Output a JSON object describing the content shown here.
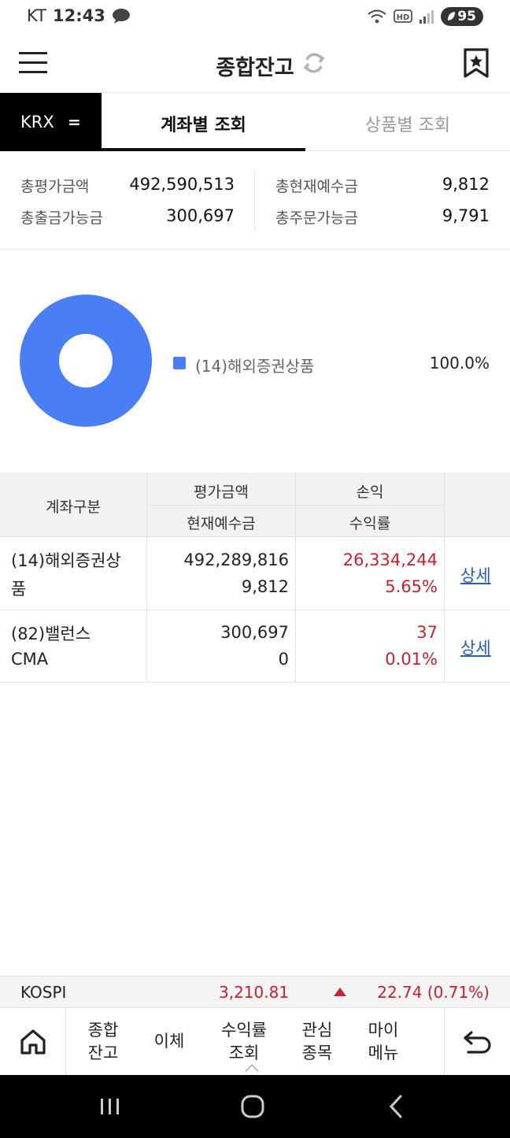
{
  "status_bar": {
    "carrier": "KT",
    "time": "12:43",
    "battery": "95"
  },
  "header": {
    "title": "종합잔고"
  },
  "tabs": {
    "exchange": "KRX",
    "exchange_icon": "=",
    "items": [
      {
        "label": "계좌별 조회",
        "active": true
      },
      {
        "label": "상품별 조회",
        "active": false
      }
    ]
  },
  "summary": {
    "left": [
      {
        "label": "총평가금액",
        "value": "492,590,513"
      },
      {
        "label": "총출금가능금",
        "value": "300,697"
      }
    ],
    "right": [
      {
        "label": "총현재예수금",
        "value": "9,812"
      },
      {
        "label": "총주문가능금",
        "value": "9,791"
      }
    ]
  },
  "chart_data": {
    "type": "pie",
    "categories": [
      "(14)해외증권상품"
    ],
    "values": [
      100.0
    ],
    "value_labels": [
      "100.0%"
    ],
    "colors": [
      "#4a7ef5"
    ],
    "legend_position": "right"
  },
  "table": {
    "headers": {
      "account": "계좌구분",
      "eval_amount": "평가금액",
      "deposit": "현재예수금",
      "profit": "손익",
      "return_rate": "수익률"
    },
    "rows": [
      {
        "account_line1": "(14)해외증권상",
        "account_line2": "품",
        "eval_amount": "492,289,816",
        "deposit": "9,812",
        "profit": "26,334,244",
        "return_rate": "5.65%",
        "detail": "상세"
      },
      {
        "account_line1": "(82)밸런스",
        "account_line2": "CMA",
        "eval_amount": "300,697",
        "deposit": "0",
        "profit": "37",
        "return_rate": "0.01%",
        "detail": "상세"
      }
    ]
  },
  "ticker": {
    "name": "KOSPI",
    "price": "3,210.81",
    "change": "22.74 (0.71%)",
    "color_up": "#c8202f"
  },
  "bottom_nav": {
    "items": [
      {
        "line1": "종합",
        "line2": "잔고"
      },
      {
        "line1": "이체",
        "line2": ""
      },
      {
        "line1": "수익률",
        "line2": "조회"
      },
      {
        "line1": "관심",
        "line2": "종목"
      },
      {
        "line1": "마이",
        "line2": "메뉴"
      }
    ]
  },
  "icons": {
    "menu": "hamburger-icon",
    "refresh": "refresh-icon",
    "bookmark": "bookmark-star-icon",
    "home": "home-icon",
    "back": "back-arrow-icon"
  }
}
